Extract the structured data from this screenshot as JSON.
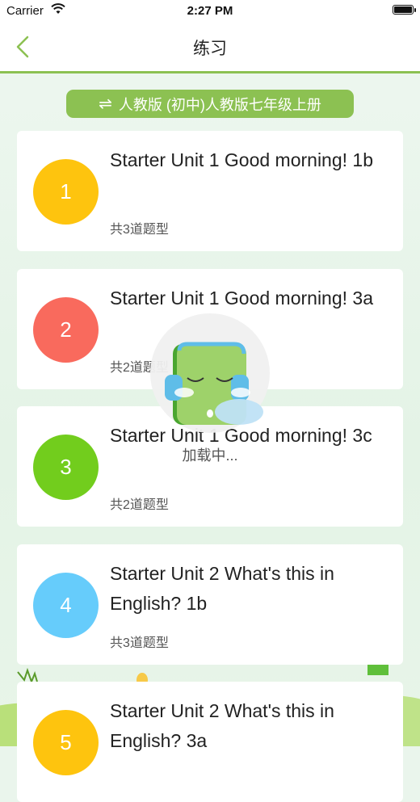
{
  "status_bar": {
    "carrier": "Carrier",
    "time": "2:27 PM"
  },
  "nav": {
    "title": "练习",
    "back_icon": "chevron-left-icon"
  },
  "book": {
    "label": "人教版 (初中)人教版七年级上册",
    "swap_icon": "⇌"
  },
  "units": [
    {
      "number": "1",
      "title": "Starter Unit 1 Good morning! 1b",
      "count": "共3道题型",
      "color": "#fec40e"
    },
    {
      "number": "2",
      "title": "Starter Unit 1 Good morning! 3a",
      "count": "共2道题型",
      "color": "#f96a5d"
    },
    {
      "number": "3",
      "title": "Starter Unit 1 Good morning! 3c",
      "count": "共2道题型",
      "color": "#72cd1d"
    },
    {
      "number": "4",
      "title": "Starter Unit 2 What's this in English? 1b",
      "count": "共3道题型",
      "color": "#66ccfb"
    },
    {
      "number": "5",
      "title": "Starter Unit 2 What's this in English? 3a",
      "count": "",
      "color": "#fec40e"
    }
  ],
  "loading": {
    "text": "加载中..."
  },
  "colors": {
    "accent": "#8cc152"
  }
}
